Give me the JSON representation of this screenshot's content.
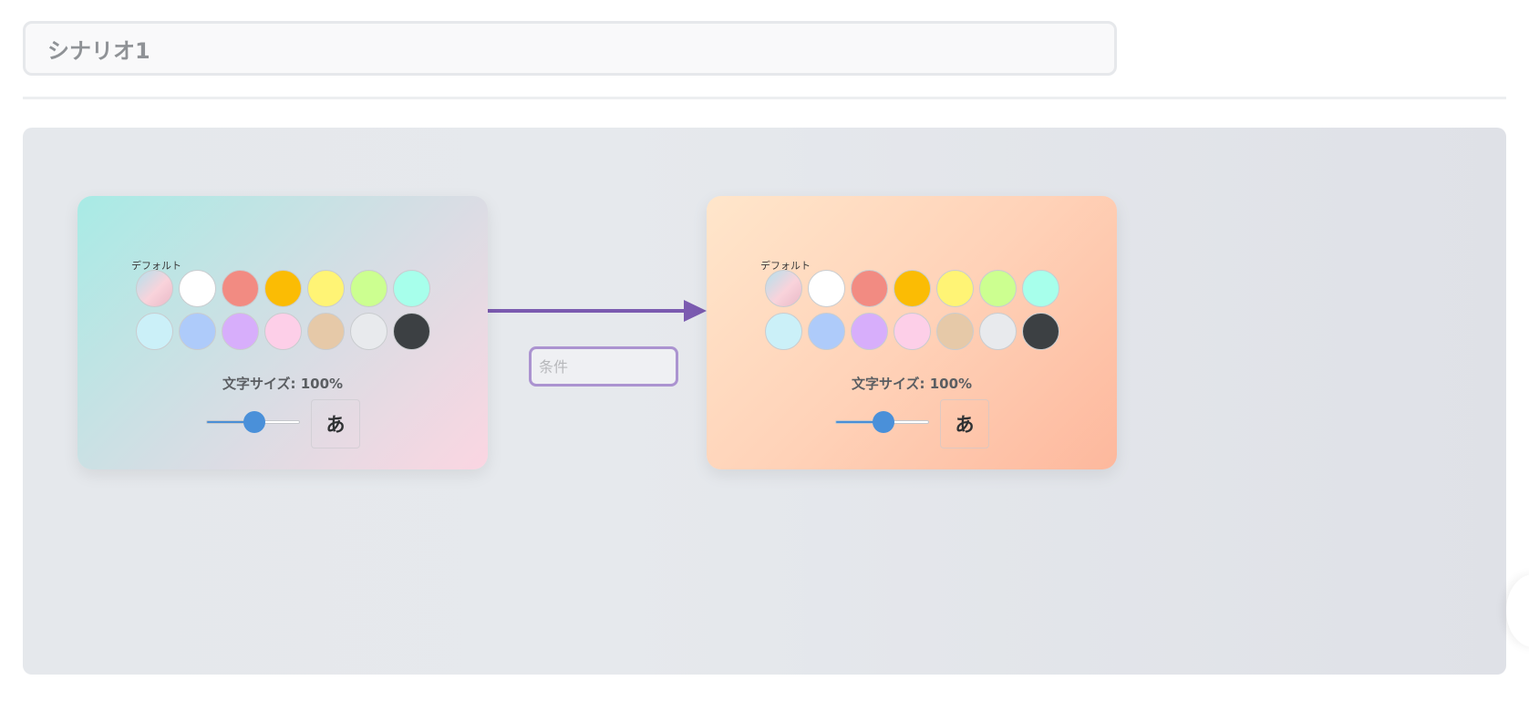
{
  "scenario": {
    "title": "シナリオ1"
  },
  "colors": {
    "swatches": [
      "gradient",
      "#ffffff",
      "#f28b82",
      "#fbbc04",
      "#fff475",
      "#ccff90",
      "#a7ffeb",
      "#cbf0f8",
      "#aecbfa",
      "#d7aefb",
      "#fdcfe8",
      "#e6c9a8",
      "#e8eaed",
      "#3c4043"
    ],
    "edge": "#7b5bb0"
  },
  "nodes": [
    {
      "palette_label": "デフォルト",
      "font_size_label": "文字サイズ: 100%",
      "font_size_percent": 100,
      "slider_fraction": 0.5,
      "preview_char": "あ"
    },
    {
      "palette_label": "デフォルト",
      "font_size_label": "文字サイズ: 100%",
      "font_size_percent": 100,
      "slider_fraction": 0.5,
      "preview_char": "あ"
    }
  ],
  "edge": {
    "condition_placeholder": "条件"
  }
}
